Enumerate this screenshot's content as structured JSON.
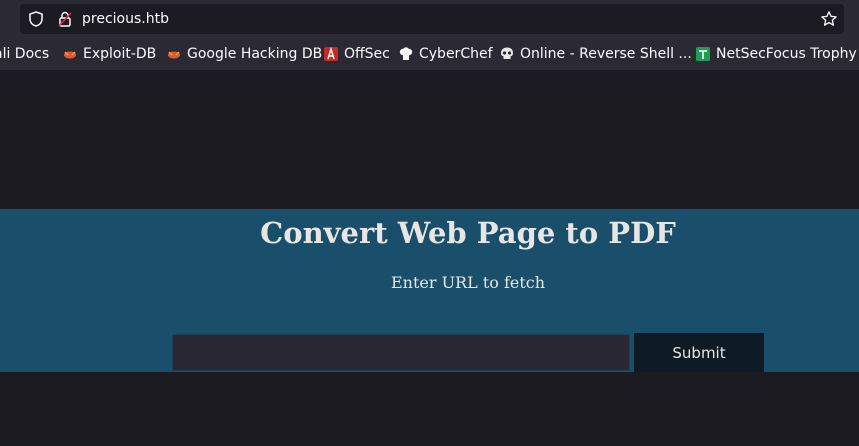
{
  "browser": {
    "url": "precious.htb",
    "bookmarks": [
      {
        "label": "ali Docs",
        "icon": "kali-docs-icon"
      },
      {
        "label": "Exploit-DB",
        "icon": "exploit-db-icon"
      },
      {
        "label": "Google Hacking DB",
        "icon": "ghdb-icon"
      },
      {
        "label": "OffSec",
        "icon": "offsec-icon"
      },
      {
        "label": "CyberChef",
        "icon": "cyberchef-icon"
      },
      {
        "label": "Online - Reverse Shell ...",
        "icon": "skull-icon"
      },
      {
        "label": "NetSecFocus Trophy R",
        "icon": "sheets-icon"
      }
    ]
  },
  "main": {
    "title": "Convert Web Page to PDF",
    "subtitle": "Enter URL to fetch",
    "input_value": "",
    "submit_label": "Submit"
  },
  "colors": {
    "hero_bg": "#1a4f6b",
    "page_bg": "#1c1b22",
    "toolbar_bg": "#2b2a33"
  }
}
